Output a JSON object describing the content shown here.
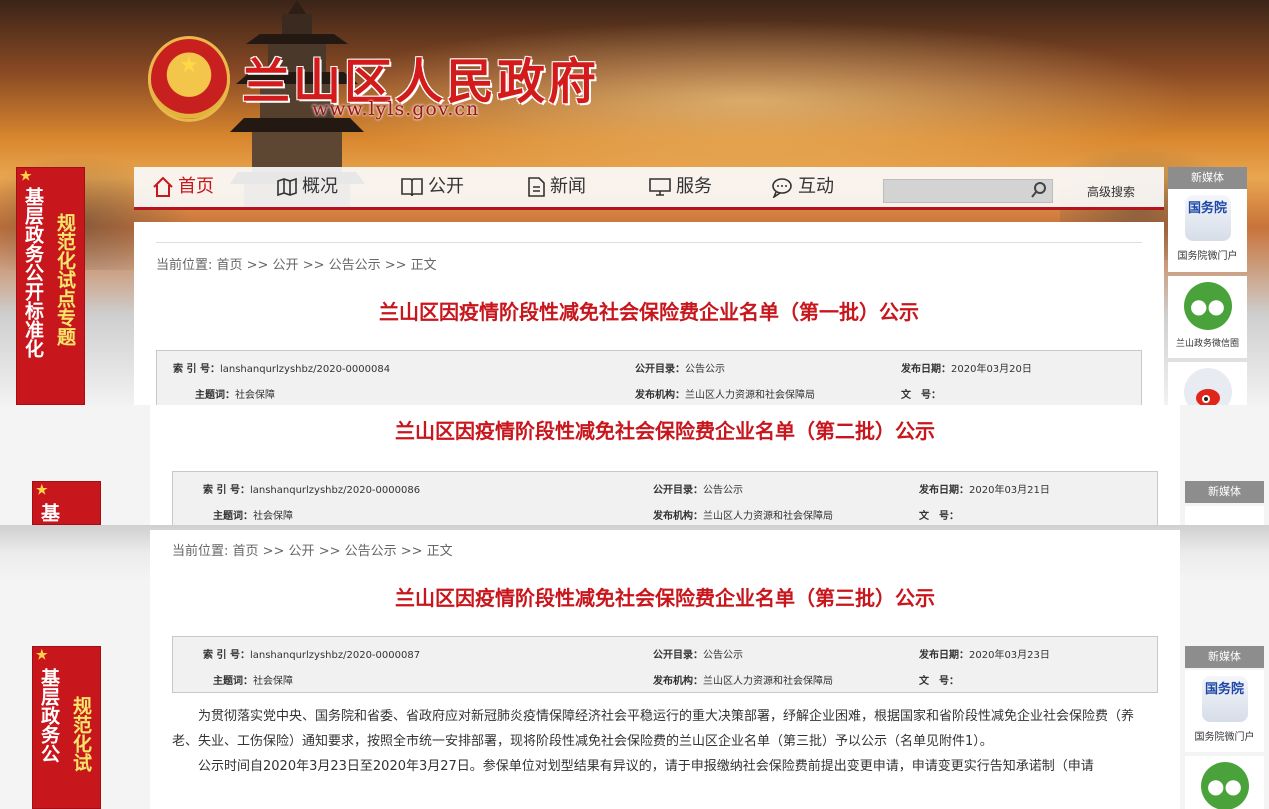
{
  "header": {
    "site_title": "兰山区人民政府",
    "site_url": "www.lyls.gov.cn"
  },
  "ribbon": {
    "col1": "基层政务公开标准化",
    "col2": "规范化试点专题",
    "col1_short": "基",
    "col1_mid": "基层政务公",
    "col2_mid": "规范化试"
  },
  "nav": {
    "items": [
      {
        "label": "首页",
        "icon": "home-icon"
      },
      {
        "label": "概况",
        "icon": "map-icon"
      },
      {
        "label": "公开",
        "icon": "book-icon"
      },
      {
        "label": "新闻",
        "icon": "document-icon"
      },
      {
        "label": "服务",
        "icon": "monitor-icon"
      },
      {
        "label": "互动",
        "icon": "chat-icon"
      }
    ],
    "search_placeholder": "",
    "advanced_search": "高级搜索"
  },
  "sidebar": {
    "head": "新媒体",
    "gwy_logo": "国务院",
    "gwy_label": "国务院微门户",
    "wx_label": "兰山政务微信圈",
    "gwy_label_bottom": "国务院微门户"
  },
  "breadcrumb": "当前位置: 首页 >> 公开 >> 公告公示 >> 正文",
  "docs": [
    {
      "title": "兰山区因疫情阶段性减免社会保险费企业名单（第一批）公示",
      "index_label": "索 引 号：",
      "index": "lanshanqurlzyshbz/2020-0000084",
      "catalog_label": "公开目录：",
      "catalog": "公告公示",
      "date_label": "发布日期：",
      "date": "2020年03月20日",
      "topic_label": "主题词：",
      "topic": "社会保障",
      "org_label": "发布机构：",
      "org": "兰山区人力资源和社会保障局",
      "docno_label": "文　号："
    },
    {
      "title": "兰山区因疫情阶段性减免社会保险费企业名单（第二批）公示",
      "index_label": "索 引 号：",
      "index": "lanshanqurlzyshbz/2020-0000086",
      "catalog_label": "公开目录：",
      "catalog": "公告公示",
      "date_label": "发布日期：",
      "date": "2020年03月21日",
      "topic_label": "主题词：",
      "topic": "社会保障",
      "org_label": "发布机构：",
      "org": "兰山区人力资源和社会保障局",
      "docno_label": "文　号："
    },
    {
      "title": "兰山区因疫情阶段性减免社会保险费企业名单（第三批）公示",
      "index_label": "索 引 号：",
      "index": "lanshanqurlzyshbz/2020-0000087",
      "catalog_label": "公开目录：",
      "catalog": "公告公示",
      "date_label": "发布日期：",
      "date": "2020年03月23日",
      "topic_label": "主题词：",
      "topic": "社会保障",
      "org_label": "发布机构：",
      "org": "兰山区人力资源和社会保障局",
      "docno_label": "文　号："
    }
  ],
  "body": {
    "para1": "为贯彻落实党中央、国务院和省委、省政府应对新冠肺炎疫情保障经济社会平稳运行的重大决策部署，纾解企业困难，根据国家和省阶段性减免企业社会保险费（养老、失业、工伤保险）通知要求，按照全市统一安排部署，现将阶段性减免社会保险费的兰山区企业名单（第三批）予以公示（名单见附件1）。",
    "para2": "公示时间自2020年3月23日至2020年3月27日。参保单位对划型结果有异议的，请于申报缴纳社会保险费前提出变更申请，申请变更实行告知承诺制（申请"
  },
  "colors": {
    "brand_red": "#c8161d",
    "nav_line": "#b5141b"
  }
}
